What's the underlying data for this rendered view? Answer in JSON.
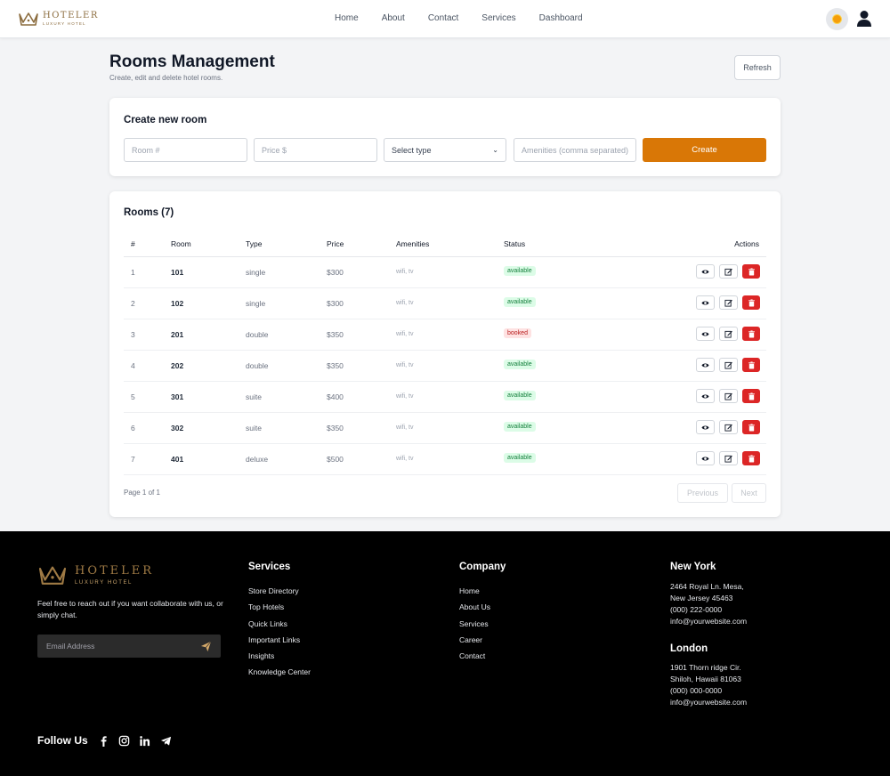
{
  "header": {
    "brand_name": "HOTELER",
    "brand_tagline": "LUXURY HOTEL",
    "nav": [
      "Home",
      "About",
      "Contact",
      "Services",
      "Dashboard"
    ],
    "theme_icon": "sun-icon",
    "user_icon": "user-icon"
  },
  "page": {
    "title": "Rooms Management",
    "subtitle": "Create, edit and delete hotel rooms.",
    "refresh_label": "Refresh"
  },
  "create_form": {
    "title": "Create new room",
    "room_placeholder": "Room #",
    "price_placeholder": "Price $",
    "type_selected": "Select type",
    "amenities_placeholder": "Amenities (comma separated)",
    "create_label": "Create"
  },
  "rooms": {
    "title": "Rooms (7)",
    "columns": [
      "#",
      "Room",
      "Type",
      "Price",
      "Amenities",
      "Status",
      "Actions"
    ],
    "rows": [
      {
        "n": "1",
        "room": "101",
        "type": "single",
        "price": "$300",
        "amenities": "wifi, tv",
        "status": "available"
      },
      {
        "n": "2",
        "room": "102",
        "type": "single",
        "price": "$300",
        "amenities": "wifi, tv",
        "status": "available"
      },
      {
        "n": "3",
        "room": "201",
        "type": "double",
        "price": "$350",
        "amenities": "wifi, tv",
        "status": "booked"
      },
      {
        "n": "4",
        "room": "202",
        "type": "double",
        "price": "$350",
        "amenities": "wifi, tv",
        "status": "available"
      },
      {
        "n": "5",
        "room": "301",
        "type": "suite",
        "price": "$400",
        "amenities": "wifi, tv",
        "status": "available"
      },
      {
        "n": "6",
        "room": "302",
        "type": "suite",
        "price": "$350",
        "amenities": "wifi, tv",
        "status": "available"
      },
      {
        "n": "7",
        "room": "401",
        "type": "deluxe",
        "price": "$500",
        "amenities": "wifi, tv",
        "status": "available"
      }
    ],
    "page_info": "Page 1 of 1",
    "prev_label": "Previous",
    "next_label": "Next"
  },
  "footer": {
    "brand_name": "HOTELER",
    "brand_tagline": "LUXURY HOTEL",
    "description": "Feel free to reach out if you want collaborate with us, or simply chat.",
    "email_placeholder": "Email Address",
    "services_title": "Services",
    "services": [
      "Store Directory",
      "Top Hotels",
      "Quick Links",
      "Important Links",
      "Insights",
      "Knowledge Center"
    ],
    "company_title": "Company",
    "company": [
      "Home",
      "About Us",
      "Services",
      "Career",
      "Contact"
    ],
    "new_york": {
      "city": "New York",
      "lines": [
        "2464 Royal Ln. Mesa,",
        "New Jersey 45463",
        "(000) 222-0000",
        "info@yourwebsite.com"
      ]
    },
    "london": {
      "city": "London",
      "lines": [
        "1901 Thorn ridge Cir.",
        "Shiloh, Hawaii 81063",
        "(000) 000-0000",
        "info@yourwebsite.com"
      ]
    },
    "follow_label": "Follow Us",
    "social_icons": [
      "facebook-icon",
      "instagram-icon",
      "linkedin-icon",
      "telegram-icon"
    ]
  },
  "colors": {
    "accent": "#d97706",
    "brand_gold": "#a07b45",
    "danger": "#dc2626",
    "available_bg": "#dcfce7",
    "booked_bg": "#fee2e2"
  }
}
